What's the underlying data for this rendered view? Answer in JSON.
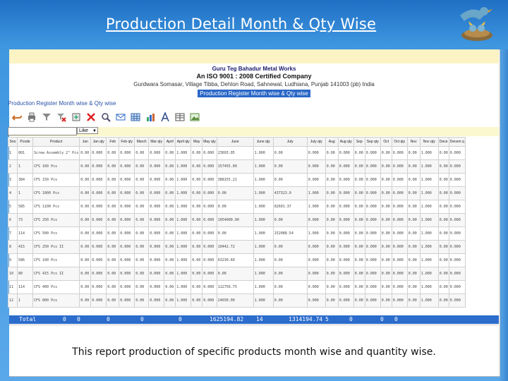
{
  "slide": {
    "title": "Production Detail Month & Qty Wise",
    "caption": "This report production of specific products month wise and quantity wise."
  },
  "report": {
    "company_name": "Guru Teg Bahadur Metal Works",
    "certification": "An ISO 9001 : 2008 Certified Company",
    "address": "Gurdwara Somasar, Village Tibba, Dehlon Road, Sahnewal, Ludhiana, Punjab 141003 (pb) India",
    "report_name": "Production Register Month wise & Qty wise",
    "register_title": "Production Register Month wise & Qty wise",
    "filter_option": "Like",
    "toolbar_icons": [
      "undo-icon",
      "print-icon",
      "filter-icon",
      "clear-filter-icon",
      "export-icon",
      "clear-icon",
      "view-icon",
      "email-icon",
      "grid-icon",
      "chart-icon",
      "font-icon",
      "table-icon",
      "image-icon"
    ],
    "columns": [
      "Sno",
      "Pcode",
      "Product",
      "Jan",
      "Jan qty",
      "Feb",
      "Feb qty",
      "March",
      "Mar qty",
      "April",
      "April qty",
      "May",
      "May qty",
      "June",
      "June qty",
      "July",
      "July qty",
      "Aug",
      "Aug qty",
      "Sep",
      "Sep qty",
      "Oct",
      "Oct qty",
      "Nov",
      "Nov qty",
      "Dece",
      "Decem q"
    ],
    "rows": [
      [
        "1",
        "001",
        "Screw Assembly 2\" Pcs",
        "0.00",
        "0.000",
        "0.00",
        "0.000",
        "0.00",
        "0.000",
        "0.00",
        "1.000",
        "0.00",
        "0.000",
        "23693.05",
        "1.000",
        "0.00",
        "0.000",
        "0.00",
        "0.000",
        "0.00",
        "0.000",
        "0.00",
        "0.000",
        "0.00",
        "1.000",
        "0.00",
        "0.000"
      ],
      [
        "2",
        "1",
        "CFS 160 Pcs",
        "0.00",
        "0.000",
        "0.00",
        "0.000",
        "0.00",
        "0.000",
        "0.00",
        "1.000",
        "0.00",
        "0.000",
        "157455.00",
        "1.000",
        "0.00",
        "0.000",
        "0.00",
        "0.000",
        "0.00",
        "0.000",
        "0.00",
        "0.000",
        "0.00",
        "1.000",
        "0.00",
        "0.000"
      ],
      [
        "3",
        "384",
        "CFS 150 Pcs",
        "0.00",
        "0.000",
        "0.00",
        "0.000",
        "0.00",
        "0.000",
        "0.00",
        "1.000",
        "0.00",
        "0.000",
        "388155.21",
        "1.000",
        "0.00",
        "0.000",
        "0.00",
        "0.000",
        "0.00",
        "0.000",
        "0.00",
        "0.000",
        "0.00",
        "1.000",
        "0.00",
        "0.000"
      ],
      [
        "4",
        "1",
        "CFS 1000 Pcs",
        "0.00",
        "0.000",
        "0.00",
        "0.000",
        "0.00",
        "0.000",
        "0.00",
        "1.000",
        "0.00",
        "0.000",
        "0.00",
        "1.000",
        "437323.0",
        "1.000",
        "0.00",
        "0.000",
        "0.00",
        "0.000",
        "0.00",
        "0.000",
        "0.00",
        "1.000",
        "0.00",
        "0.000"
      ],
      [
        "5",
        "585",
        "CFS 1100 Pcs",
        "0.00",
        "0.000",
        "0.00",
        "0.000",
        "0.00",
        "0.000",
        "0.00",
        "1.000",
        "0.00",
        "0.000",
        "0.00",
        "1.000",
        "82601.37",
        "1.000",
        "0.00",
        "0.000",
        "0.00",
        "0.000",
        "0.00",
        "0.000",
        "0.00",
        "1.000",
        "0.00",
        "0.000"
      ],
      [
        "6",
        "73",
        "CFS 250 Pcs",
        "0.00",
        "0.000",
        "0.00",
        "0.000",
        "0.00",
        "0.000",
        "0.00",
        "1.000",
        "0.00",
        "0.000",
        "1054000.00",
        "1.000",
        "0.00",
        "0.000",
        "0.00",
        "0.000",
        "0.00",
        "0.000",
        "0.00",
        "0.000",
        "0.00",
        "1.000",
        "0.00",
        "0.000"
      ],
      [
        "7",
        "114",
        "CFS 500 Pcs",
        "0.00",
        "0.000",
        "0.00",
        "0.000",
        "0.00",
        "0.000",
        "0.00",
        "1.000",
        "0.00",
        "0.000",
        "0.00",
        "1.000",
        "152088.54",
        "1.000",
        "0.00",
        "0.000",
        "0.00",
        "0.000",
        "0.00",
        "0.000",
        "0.00",
        "1.000",
        "0.00",
        "0.000"
      ],
      [
        "8",
        "415",
        "CFS 250 Pcs II",
        "0.00",
        "0.000",
        "0.00",
        "0.000",
        "0.00",
        "0.000",
        "0.00",
        "1.000",
        "0.00",
        "0.000",
        "10442.72",
        "1.000",
        "0.00",
        "0.000",
        "0.00",
        "0.000",
        "0.00",
        "0.000",
        "0.00",
        "0.000",
        "0.00",
        "1.000",
        "0.00",
        "0.000"
      ],
      [
        "9",
        "586",
        "CFS 100 Pcs",
        "0.00",
        "0.000",
        "0.00",
        "0.000",
        "0.00",
        "0.000",
        "0.00",
        "1.000",
        "0.00",
        "0.000",
        "63230.60",
        "1.000",
        "0.00",
        "0.000",
        "0.00",
        "0.000",
        "0.00",
        "0.000",
        "0.00",
        "0.000",
        "0.00",
        "1.000",
        "0.00",
        "0.000"
      ],
      [
        "10",
        "80",
        "CFS 415 Pcs II",
        "0.00",
        "0.000",
        "0.00",
        "0.000",
        "0.00",
        "0.000",
        "0.00",
        "1.000",
        "0.00",
        "0.000",
        "0.00",
        "1.000",
        "0.00",
        "0.000",
        "0.00",
        "0.000",
        "0.00",
        "0.000",
        "0.00",
        "0.000",
        "0.00",
        "1.000",
        "0.00",
        "0.000"
      ],
      [
        "11",
        "114",
        "CFS 400 Pcs",
        "0.00",
        "0.000",
        "0.00",
        "0.000",
        "0.00",
        "0.000",
        "0.00",
        "1.000",
        "0.00",
        "0.000",
        "112756.75",
        "1.000",
        "0.00",
        "0.000",
        "0.00",
        "0.000",
        "0.00",
        "0.000",
        "0.00",
        "0.000",
        "0.00",
        "1.000",
        "0.00",
        "0.000"
      ],
      [
        "12",
        "1",
        "CFS 800 Pcs",
        "0.00",
        "0.000",
        "0.00",
        "0.000",
        "0.00",
        "0.000",
        "0.00",
        "1.000",
        "0.00",
        "0.000",
        "24030.00",
        "1.000",
        "0.00",
        "0.000",
        "0.00",
        "0.000",
        "0.00",
        "0.000",
        "0.00",
        "0.000",
        "0.00",
        "1.000",
        "0.00",
        "0.000"
      ]
    ],
    "total": {
      "label": "Total",
      "jan": "0",
      "feb": "0",
      "mar": "0",
      "apr": "0",
      "may": "0",
      "june": "1625194.82",
      "june_qty": "14",
      "july": "1314194.74",
      "july_qty": "5",
      "aug": "0",
      "sep": "0",
      "oct": "0"
    }
  },
  "colors": {
    "total_bar": "#2b6ccc",
    "filter_row": "#fbf7cf",
    "slide_bg": "#3f97e0"
  }
}
